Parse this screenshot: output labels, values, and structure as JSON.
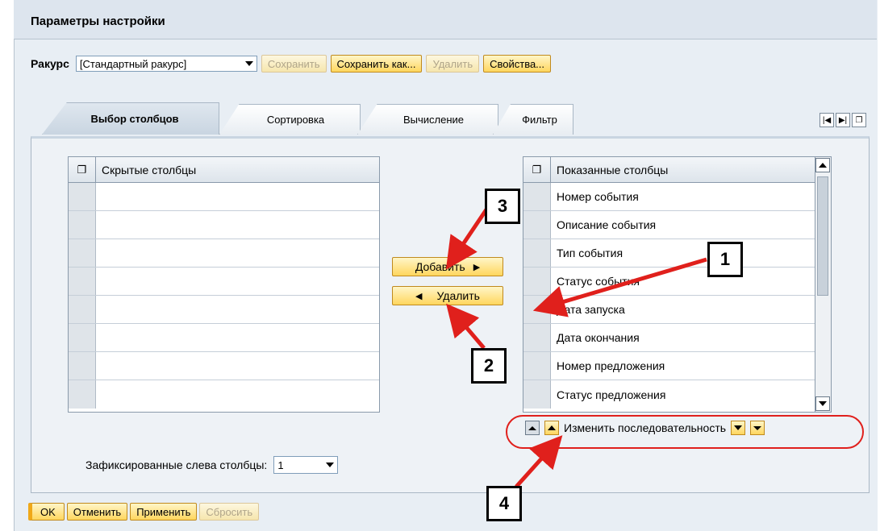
{
  "header": {
    "title": "Параметры настройки"
  },
  "view": {
    "label": "Ракурс",
    "selected": "[Стандартный ракурс]",
    "buttons": {
      "save": "Сохранить",
      "save_as": "Сохранить как...",
      "delete": "Удалить",
      "properties": "Свойства..."
    }
  },
  "tabs": [
    "Выбор столбцов",
    "Сортировка",
    "Вычисление",
    "Фильтр"
  ],
  "active_tab": "Выбор столбцов",
  "hidden_columns": {
    "header": "Скрытые столбцы",
    "rows": [
      "",
      "",
      "",
      "",
      "",
      "",
      "",
      ""
    ]
  },
  "shown_columns": {
    "header": "Показанные столбцы",
    "rows": [
      "Номер события",
      "Описание события",
      "Тип события",
      "Статус события",
      "Дата запуска",
      "Дата окончания",
      "Номер предложения",
      "Статус предложения"
    ]
  },
  "transfer": {
    "add": "Добавить",
    "remove": "Удалить"
  },
  "sequence": {
    "label": "Изменить последовательность"
  },
  "frozen": {
    "label": "Зафиксированные слева столбцы:",
    "value": "1"
  },
  "footer": {
    "ok": "OK",
    "cancel": "Отменить",
    "apply": "Применить",
    "reset": "Сбросить"
  },
  "callouts": [
    "1",
    "2",
    "3",
    "4"
  ],
  "colors": {
    "accent_button": "#ffd65e",
    "callout_arrow": "#e0201c",
    "panel_bg": "#eef2f6"
  }
}
